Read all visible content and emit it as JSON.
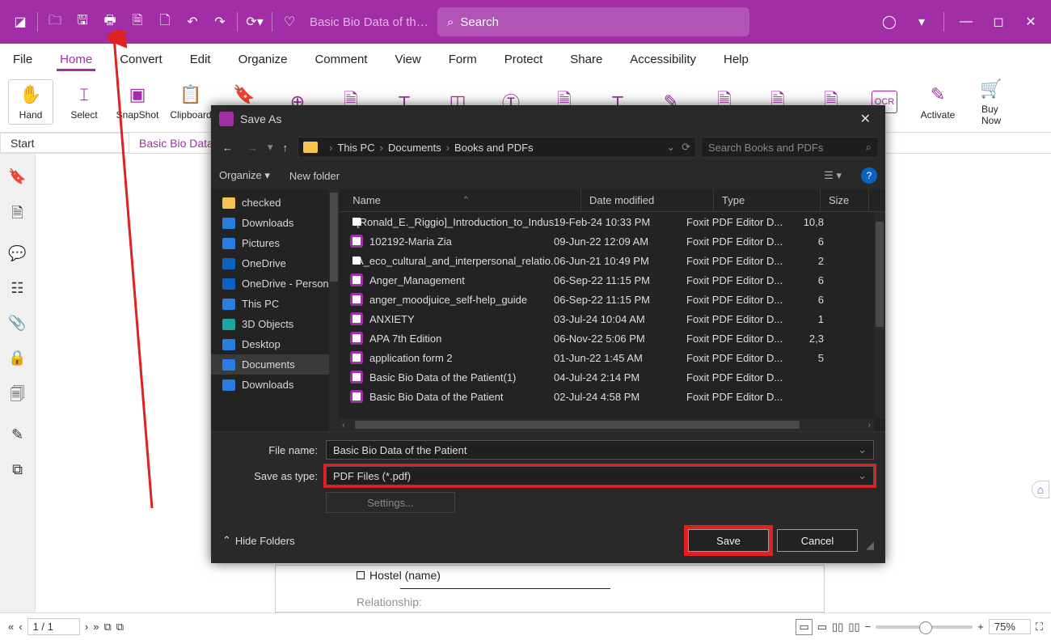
{
  "titlebar": {
    "doc_title": "Basic Bio Data of the P...",
    "search_placeholder": "Search"
  },
  "menubar": [
    "File",
    "Home",
    "Convert",
    "Edit",
    "Organize",
    "Comment",
    "View",
    "Form",
    "Protect",
    "Share",
    "Accessibility",
    "Help"
  ],
  "ribbon": {
    "tools": [
      "Hand",
      "Select",
      "SnapShot",
      "Clipboard",
      "Bookmark"
    ],
    "activate": "Activate",
    "buynow_line1": "Buy",
    "buynow_line2": "Now"
  },
  "tabstrip": {
    "start": "Start",
    "doc": "Basic Bio Data"
  },
  "doc_visible": {
    "hostel_label": "Hostel (name)",
    "relationship": "Relationship:"
  },
  "dialog": {
    "title": "Save As",
    "nav_back": "←",
    "nav_fwd": "→",
    "nav_up": "↑",
    "path": [
      "This PC",
      "Documents",
      "Books and PDFs"
    ],
    "search_placeholder": "Search Books and PDFs",
    "toolbar_organize": "Organize ▾",
    "toolbar_newfolder": "New folder",
    "tree": [
      {
        "label": "checked",
        "icon": "#f5c451"
      },
      {
        "label": "Downloads",
        "icon": "#2a7de1"
      },
      {
        "label": "Pictures",
        "icon": "#2a7de1"
      },
      {
        "label": "OneDrive",
        "icon": "#0a63c2"
      },
      {
        "label": "OneDrive - Person",
        "icon": "#0a63c2"
      },
      {
        "label": "This PC",
        "icon": "#2a7de1"
      },
      {
        "label": "3D Objects",
        "icon": "#1aa6a0"
      },
      {
        "label": "Desktop",
        "icon": "#2a7de1"
      },
      {
        "label": "Documents",
        "icon": "#2a7de1",
        "selected": true
      },
      {
        "label": "Downloads",
        "icon": "#2a7de1"
      }
    ],
    "columns": {
      "name": "Name",
      "date": "Date modified",
      "type": "Type",
      "size": "Size"
    },
    "files": [
      {
        "name": "[Ronald_E._Riggio]_Introduction_to_Indus...",
        "date": "19-Feb-24 10:33 PM",
        "type": "Foxit PDF Editor D...",
        "size": "10,8"
      },
      {
        "name": "102192-Maria Zia",
        "date": "09-Jun-22 12:09 AM",
        "type": "Foxit PDF Editor D...",
        "size": "6"
      },
      {
        "name": "A_eco_cultural_and_interpersonal_relatio...",
        "date": "06-Jun-21 10:49 PM",
        "type": "Foxit PDF Editor D...",
        "size": "2"
      },
      {
        "name": "Anger_Management",
        "date": "06-Sep-22 11:15 PM",
        "type": "Foxit PDF Editor D...",
        "size": "6"
      },
      {
        "name": "anger_moodjuice_self-help_guide",
        "date": "06-Sep-22 11:15 PM",
        "type": "Foxit PDF Editor D...",
        "size": "6"
      },
      {
        "name": "ANXIETY",
        "date": "03-Jul-24 10:04 AM",
        "type": "Foxit PDF Editor D...",
        "size": "1"
      },
      {
        "name": "APA 7th Edition",
        "date": "06-Nov-22 5:06 PM",
        "type": "Foxit PDF Editor D...",
        "size": "2,3"
      },
      {
        "name": "application form 2",
        "date": "01-Jun-22 1:45 AM",
        "type": "Foxit PDF Editor D...",
        "size": "5"
      },
      {
        "name": "Basic Bio Data of the Patient(1)",
        "date": "04-Jul-24 2:14 PM",
        "type": "Foxit PDF Editor D...",
        "size": ""
      },
      {
        "name": "Basic Bio Data of the Patient",
        "date": "02-Jul-24 4:58 PM",
        "type": "Foxit PDF Editor D...",
        "size": ""
      }
    ],
    "filename_label": "File name:",
    "filename_value": "Basic Bio Data of the Patient",
    "saveastype_label": "Save as type:",
    "saveastype_value": "PDF Files (*.pdf)",
    "settings": "Settings...",
    "hide_folders": "Hide Folders",
    "save": "Save",
    "cancel": "Cancel"
  },
  "status": {
    "page": "1 / 1",
    "zoom": "75%"
  }
}
